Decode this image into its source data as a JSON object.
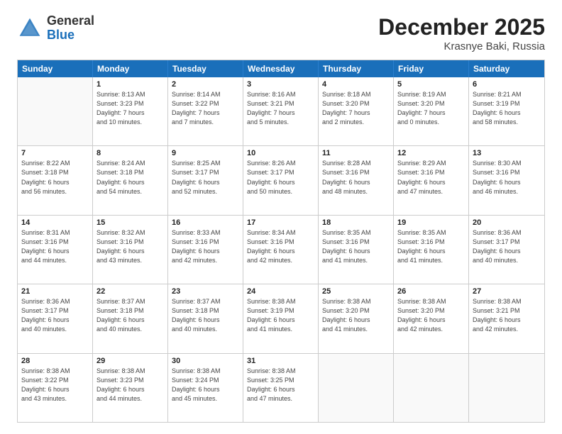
{
  "header": {
    "logo_general": "General",
    "logo_blue": "Blue",
    "month_title": "December 2025",
    "location": "Krasnye Baki, Russia"
  },
  "days_of_week": [
    "Sunday",
    "Monday",
    "Tuesday",
    "Wednesday",
    "Thursday",
    "Friday",
    "Saturday"
  ],
  "weeks": [
    [
      {
        "day": "",
        "empty": true,
        "lines": []
      },
      {
        "day": "1",
        "empty": false,
        "lines": [
          "Sunrise: 8:13 AM",
          "Sunset: 3:23 PM",
          "Daylight: 7 hours",
          "and 10 minutes."
        ]
      },
      {
        "day": "2",
        "empty": false,
        "lines": [
          "Sunrise: 8:14 AM",
          "Sunset: 3:22 PM",
          "Daylight: 7 hours",
          "and 7 minutes."
        ]
      },
      {
        "day": "3",
        "empty": false,
        "lines": [
          "Sunrise: 8:16 AM",
          "Sunset: 3:21 PM",
          "Daylight: 7 hours",
          "and 5 minutes."
        ]
      },
      {
        "day": "4",
        "empty": false,
        "lines": [
          "Sunrise: 8:18 AM",
          "Sunset: 3:20 PM",
          "Daylight: 7 hours",
          "and 2 minutes."
        ]
      },
      {
        "day": "5",
        "empty": false,
        "lines": [
          "Sunrise: 8:19 AM",
          "Sunset: 3:20 PM",
          "Daylight: 7 hours",
          "and 0 minutes."
        ]
      },
      {
        "day": "6",
        "empty": false,
        "lines": [
          "Sunrise: 8:21 AM",
          "Sunset: 3:19 PM",
          "Daylight: 6 hours",
          "and 58 minutes."
        ]
      }
    ],
    [
      {
        "day": "7",
        "empty": false,
        "lines": [
          "Sunrise: 8:22 AM",
          "Sunset: 3:18 PM",
          "Daylight: 6 hours",
          "and 56 minutes."
        ]
      },
      {
        "day": "8",
        "empty": false,
        "lines": [
          "Sunrise: 8:24 AM",
          "Sunset: 3:18 PM",
          "Daylight: 6 hours",
          "and 54 minutes."
        ]
      },
      {
        "day": "9",
        "empty": false,
        "lines": [
          "Sunrise: 8:25 AM",
          "Sunset: 3:17 PM",
          "Daylight: 6 hours",
          "and 52 minutes."
        ]
      },
      {
        "day": "10",
        "empty": false,
        "lines": [
          "Sunrise: 8:26 AM",
          "Sunset: 3:17 PM",
          "Daylight: 6 hours",
          "and 50 minutes."
        ]
      },
      {
        "day": "11",
        "empty": false,
        "lines": [
          "Sunrise: 8:28 AM",
          "Sunset: 3:16 PM",
          "Daylight: 6 hours",
          "and 48 minutes."
        ]
      },
      {
        "day": "12",
        "empty": false,
        "lines": [
          "Sunrise: 8:29 AM",
          "Sunset: 3:16 PM",
          "Daylight: 6 hours",
          "and 47 minutes."
        ]
      },
      {
        "day": "13",
        "empty": false,
        "lines": [
          "Sunrise: 8:30 AM",
          "Sunset: 3:16 PM",
          "Daylight: 6 hours",
          "and 46 minutes."
        ]
      }
    ],
    [
      {
        "day": "14",
        "empty": false,
        "lines": [
          "Sunrise: 8:31 AM",
          "Sunset: 3:16 PM",
          "Daylight: 6 hours",
          "and 44 minutes."
        ]
      },
      {
        "day": "15",
        "empty": false,
        "lines": [
          "Sunrise: 8:32 AM",
          "Sunset: 3:16 PM",
          "Daylight: 6 hours",
          "and 43 minutes."
        ]
      },
      {
        "day": "16",
        "empty": false,
        "lines": [
          "Sunrise: 8:33 AM",
          "Sunset: 3:16 PM",
          "Daylight: 6 hours",
          "and 42 minutes."
        ]
      },
      {
        "day": "17",
        "empty": false,
        "lines": [
          "Sunrise: 8:34 AM",
          "Sunset: 3:16 PM",
          "Daylight: 6 hours",
          "and 42 minutes."
        ]
      },
      {
        "day": "18",
        "empty": false,
        "lines": [
          "Sunrise: 8:35 AM",
          "Sunset: 3:16 PM",
          "Daylight: 6 hours",
          "and 41 minutes."
        ]
      },
      {
        "day": "19",
        "empty": false,
        "lines": [
          "Sunrise: 8:35 AM",
          "Sunset: 3:16 PM",
          "Daylight: 6 hours",
          "and 41 minutes."
        ]
      },
      {
        "day": "20",
        "empty": false,
        "lines": [
          "Sunrise: 8:36 AM",
          "Sunset: 3:17 PM",
          "Daylight: 6 hours",
          "and 40 minutes."
        ]
      }
    ],
    [
      {
        "day": "21",
        "empty": false,
        "lines": [
          "Sunrise: 8:36 AM",
          "Sunset: 3:17 PM",
          "Daylight: 6 hours",
          "and 40 minutes."
        ]
      },
      {
        "day": "22",
        "empty": false,
        "lines": [
          "Sunrise: 8:37 AM",
          "Sunset: 3:18 PM",
          "Daylight: 6 hours",
          "and 40 minutes."
        ]
      },
      {
        "day": "23",
        "empty": false,
        "lines": [
          "Sunrise: 8:37 AM",
          "Sunset: 3:18 PM",
          "Daylight: 6 hours",
          "and 40 minutes."
        ]
      },
      {
        "day": "24",
        "empty": false,
        "lines": [
          "Sunrise: 8:38 AM",
          "Sunset: 3:19 PM",
          "Daylight: 6 hours",
          "and 41 minutes."
        ]
      },
      {
        "day": "25",
        "empty": false,
        "lines": [
          "Sunrise: 8:38 AM",
          "Sunset: 3:20 PM",
          "Daylight: 6 hours",
          "and 41 minutes."
        ]
      },
      {
        "day": "26",
        "empty": false,
        "lines": [
          "Sunrise: 8:38 AM",
          "Sunset: 3:20 PM",
          "Daylight: 6 hours",
          "and 42 minutes."
        ]
      },
      {
        "day": "27",
        "empty": false,
        "lines": [
          "Sunrise: 8:38 AM",
          "Sunset: 3:21 PM",
          "Daylight: 6 hours",
          "and 42 minutes."
        ]
      }
    ],
    [
      {
        "day": "28",
        "empty": false,
        "lines": [
          "Sunrise: 8:38 AM",
          "Sunset: 3:22 PM",
          "Daylight: 6 hours",
          "and 43 minutes."
        ]
      },
      {
        "day": "29",
        "empty": false,
        "lines": [
          "Sunrise: 8:38 AM",
          "Sunset: 3:23 PM",
          "Daylight: 6 hours",
          "and 44 minutes."
        ]
      },
      {
        "day": "30",
        "empty": false,
        "lines": [
          "Sunrise: 8:38 AM",
          "Sunset: 3:24 PM",
          "Daylight: 6 hours",
          "and 45 minutes."
        ]
      },
      {
        "day": "31",
        "empty": false,
        "lines": [
          "Sunrise: 8:38 AM",
          "Sunset: 3:25 PM",
          "Daylight: 6 hours",
          "and 47 minutes."
        ]
      },
      {
        "day": "",
        "empty": true,
        "lines": []
      },
      {
        "day": "",
        "empty": true,
        "lines": []
      },
      {
        "day": "",
        "empty": true,
        "lines": []
      }
    ]
  ]
}
